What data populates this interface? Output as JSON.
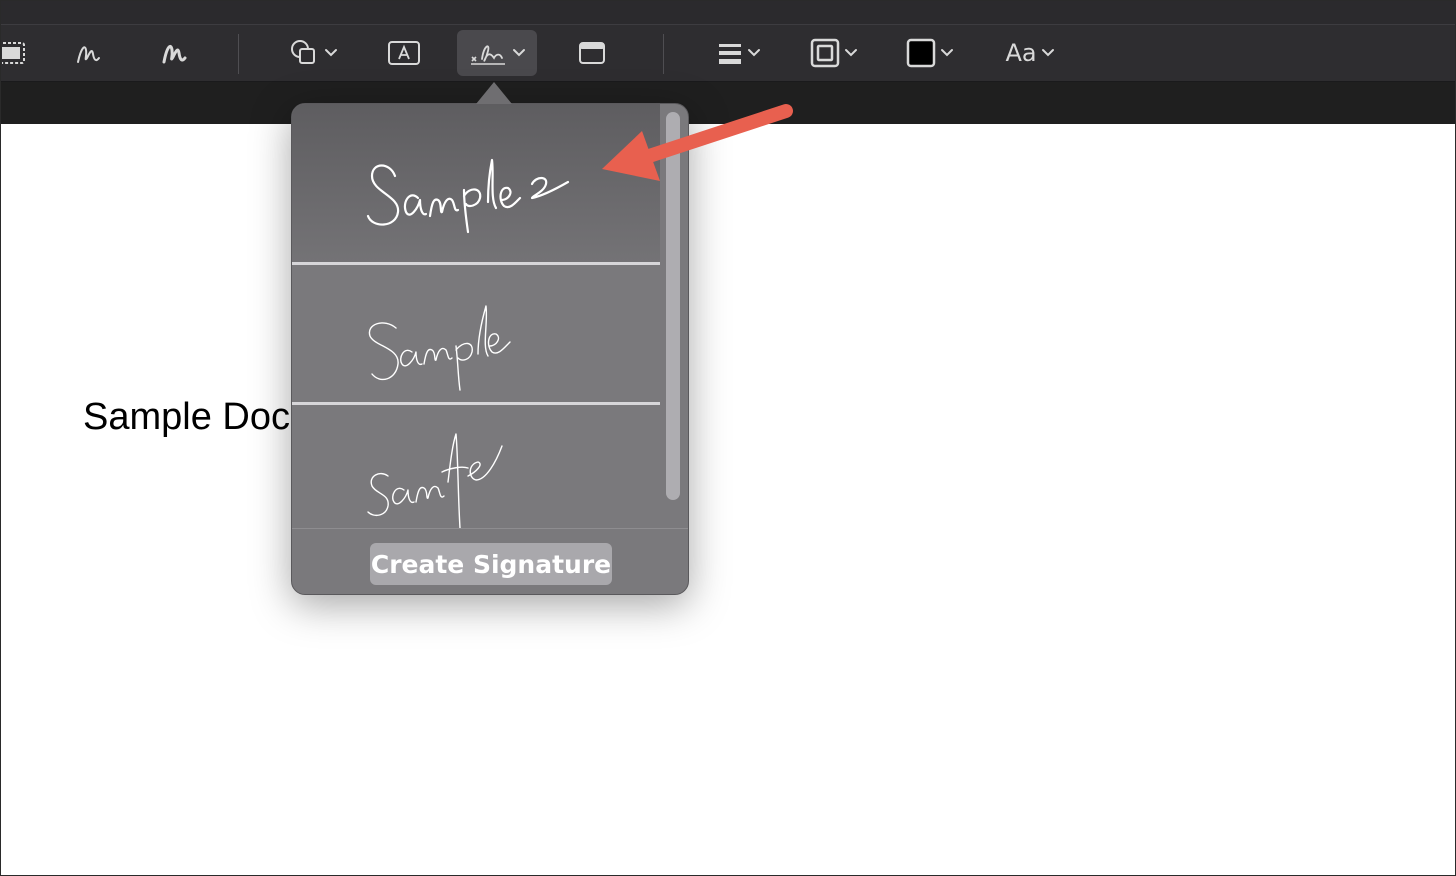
{
  "toolbar": {
    "tools": [
      {
        "name": "selection-tool",
        "icon": "rect-select-icon"
      },
      {
        "name": "sketch-tool",
        "icon": "sketch-icon"
      },
      {
        "name": "draw-tool",
        "icon": "draw-icon"
      },
      {
        "name": "shapes-tool",
        "icon": "shapes-icon"
      },
      {
        "name": "text-box-tool",
        "icon": "text-box-icon"
      },
      {
        "name": "sign-tool",
        "icon": "signature-icon",
        "active": true
      },
      {
        "name": "note-tool",
        "icon": "note-icon"
      },
      {
        "name": "shape-style-tool",
        "icon": "line-style-icon"
      },
      {
        "name": "border-color-tool",
        "icon": "border-color-icon"
      },
      {
        "name": "fill-color-tool",
        "icon": "fill-color-icon"
      },
      {
        "name": "text-style-tool",
        "icon": "text-style-icon"
      }
    ],
    "text_style_label": "Aa",
    "fill_color": "#000000"
  },
  "document": {
    "visible_text": "Sample Doc"
  },
  "signature_popover": {
    "signatures": [
      {
        "name": "signature-sample-2",
        "drawn_text": "Sample 2"
      },
      {
        "name": "signature-sample",
        "drawn_text": "Sample"
      },
      {
        "name": "signature-sample-alt",
        "drawn_text": "Sample"
      }
    ],
    "create_button_label": "Create Signature"
  },
  "annotation": {
    "arrow_color": "#e8604f"
  }
}
